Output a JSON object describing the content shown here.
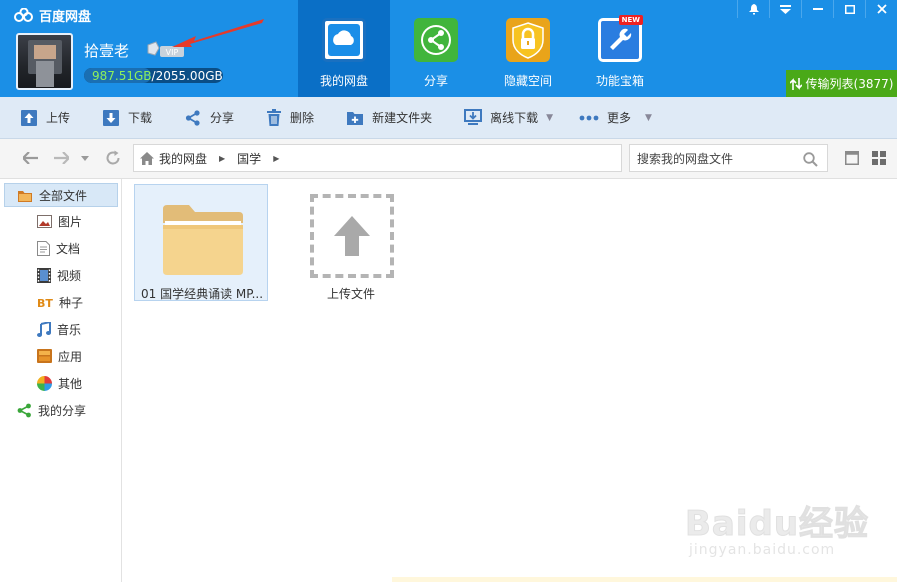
{
  "app": {
    "title": "百度网盘"
  },
  "user": {
    "name": "拾壹老",
    "vip_text": "VIP",
    "quota_used": "987.51GB",
    "quota_sep": "/",
    "quota_total": "2055.00GB",
    "quota_fraction": 0.48
  },
  "nav_tabs": [
    {
      "label": "我的网盘",
      "icon": "cloud-icon",
      "active": true
    },
    {
      "label": "分享",
      "icon": "share-icon",
      "active": false
    },
    {
      "label": "隐藏空间",
      "icon": "lock-icon",
      "active": false
    },
    {
      "label": "功能宝箱",
      "icon": "toolbox-icon",
      "active": false,
      "badge": "NEW"
    }
  ],
  "window_controls": [
    "bell-icon",
    "menu-icon",
    "minimize-icon",
    "maximize-icon",
    "close-icon"
  ],
  "transfer": {
    "label": "传输列表(3877)"
  },
  "toolbar": {
    "upload": "上传",
    "download": "下载",
    "share": "分享",
    "delete": "删除",
    "new_folder": "新建文件夹",
    "offline_download": "离线下载",
    "more": "更多"
  },
  "breadcrumb": [
    "我的网盘",
    "国学"
  ],
  "search": {
    "placeholder": "搜索我的网盘文件"
  },
  "sidebar": {
    "root": "全部文件",
    "items": [
      "图片",
      "文档",
      "视频",
      "种子",
      "音乐",
      "应用",
      "其他"
    ],
    "share": "我的分享"
  },
  "files": [
    {
      "name": "01 国学经典诵读 MP...",
      "type": "folder"
    }
  ],
  "upload_tile": {
    "label": "上传文件"
  },
  "watermark": {
    "logo": "Baidu经验",
    "url": "jingyan.baidu.com"
  },
  "colors": {
    "header_bg": "#1b8fe6",
    "active_tab": "#0a6fc6",
    "transfer_bg": "#4aa918",
    "toolbar_bg": "#dfeaf6",
    "quota_used": "#8ef05c"
  }
}
